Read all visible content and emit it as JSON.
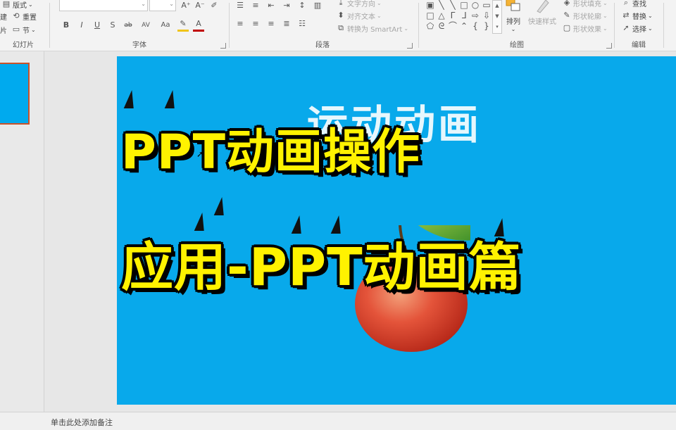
{
  "ribbon": {
    "slides_group": {
      "label": "幻灯片",
      "layout": "版式",
      "reset": "重置",
      "section": "节",
      "new_slide_partial": "建",
      "new_slide_partial2": "片"
    },
    "font_group": {
      "label": "字体",
      "format_buttons": [
        "B",
        "I",
        "U",
        "S",
        "ab",
        "AV",
        "Aa",
        "A",
        "A"
      ],
      "size_buttons": [
        "A⁺",
        "A⁻"
      ]
    },
    "paragraph_group": {
      "label": "段落",
      "text_direction": "文字方向",
      "align_text": "对齐文本",
      "convert_smartart": "转换为 SmartArt"
    },
    "drawing_group": {
      "label": "绘图",
      "arrange": "排列",
      "quick_styles": "快速样式",
      "shape_fill": "形状填充",
      "shape_outline": "形状轮廓",
      "shape_effects": "形状效果"
    },
    "editing_group": {
      "label": "编辑",
      "find": "查找",
      "replace": "替换",
      "select": "选择"
    }
  },
  "slide": {
    "background_title": "运动动画",
    "title_line1": "PPT动画操作",
    "title_line2": "应用-PPT动画篇"
  },
  "notes": {
    "placeholder": "单击此处添加备注"
  },
  "colors": {
    "slide_bg": "#08a9eb",
    "title_yellow": "#fff200",
    "thumb_border": "#c9522a"
  }
}
